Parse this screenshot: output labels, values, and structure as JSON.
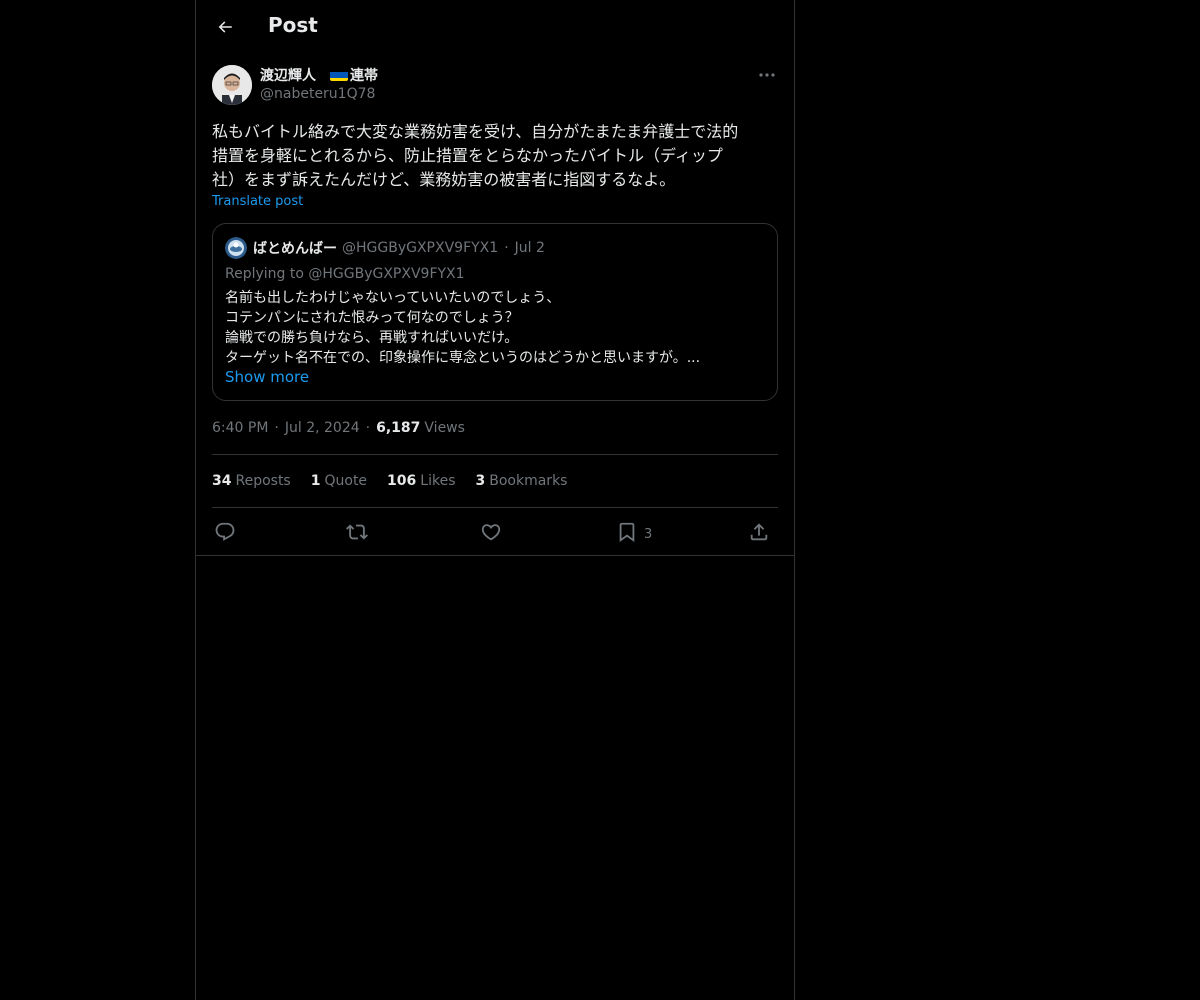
{
  "header": {
    "title": "Post"
  },
  "author": {
    "display_name": "渡辺輝人",
    "name_suffix": "連帯",
    "handle": "@nabeteru1Q78"
  },
  "tweet": {
    "text": "私もバイトル絡みで大変な業務妨害を受け、自分がたまたま弁護士で法的\n措置を身軽にとれるから、防止措置をとらなかったバイトル（ディップ\n社）をまず訴えたんだけど、業務妨害の被害者に指図するなよ。",
    "translate_label": "Translate post"
  },
  "quote": {
    "name": "ばとめんばー",
    "handle": "@HGGByGXPXV9FYX1",
    "dot": "·",
    "date": "Jul 2",
    "replying": "Replying to @HGGByGXPXV9FYX1",
    "lines": [
      "名前も出したわけじゃないっていいたいのでしょう、",
      "コテンパンにされた恨みって何なのでしょう？",
      "論戦での勝ち負けなら、再戦すればいいだけ。",
      "ターゲット名不在での、印象操作に専念というのはどうかと思いますが。..."
    ],
    "show_more": "Show more"
  },
  "meta": {
    "time": "6:40 PM",
    "dot": "·",
    "date": "Jul 2, 2024",
    "views_count": "6,187",
    "views_label": "Views"
  },
  "stats": {
    "reposts_count": "34",
    "reposts_label": "Reposts",
    "quote_count": "1",
    "quote_label": "Quote",
    "likes_count": "106",
    "likes_label": "Likes",
    "bookmarks_count": "3",
    "bookmarks_label": "Bookmarks"
  },
  "actions": {
    "bookmark_count": "3"
  },
  "colors": {
    "background": "#000000",
    "border": "#2f3336",
    "text": "#e7e9ea",
    "muted": "#71767b",
    "accent": "#1d9bf0"
  }
}
